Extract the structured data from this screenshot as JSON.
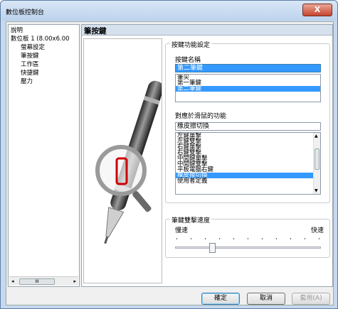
{
  "window": {
    "title": "數位板控制台",
    "close_label": "X"
  },
  "tree": {
    "items": [
      "說明",
      "數位板 1 (8.00x6.00",
      "螢幕設定",
      "筆按鍵",
      "工作區",
      "快捷鍵",
      "壓力"
    ],
    "scroll_thumb": "III"
  },
  "panel": {
    "header": "筆按鍵",
    "button_settings": {
      "legend": "按鍵功能設定",
      "name_label": "按鍵名稱",
      "name_value": "第二筆鍵",
      "name_options": [
        "筆尖",
        "第一筆鍵",
        "第二筆鍵"
      ],
      "name_selected": 2,
      "mapping_label": "對應於滑鼠的功能",
      "mapping_value": "橡皮擦切換",
      "mapping_options": [
        "左鍵單擊",
        "左鍵雙擊",
        "右鍵單擊",
        "右鍵雙擊",
        "中間鍵單擊",
        "中間鍵雙擊",
        "平板電腦右鍵",
        "橡皮擦切換",
        "使用者定義"
      ],
      "mapping_selected": 7
    },
    "double_click": {
      "legend": "筆鍵雙擊速度",
      "slow_label": "慢速",
      "fast_label": "快速",
      "speed": 0.25
    }
  },
  "footer": {
    "ok": "確定",
    "cancel": "取消",
    "apply": "套用(A)"
  }
}
